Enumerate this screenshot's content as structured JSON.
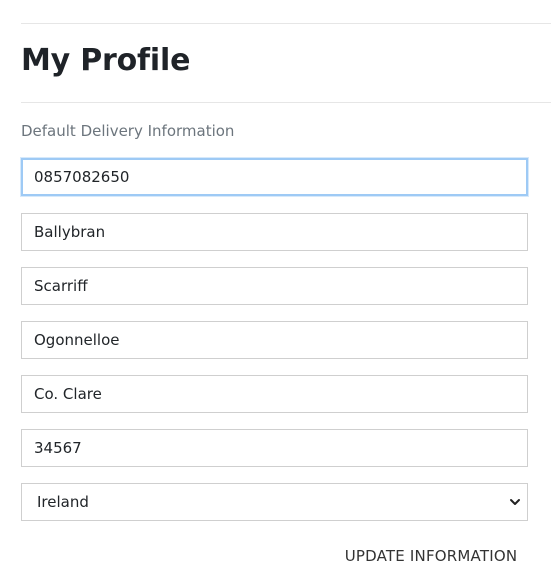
{
  "profile": {
    "title": "My Profile",
    "section_label": "Default Delivery Information",
    "fields": {
      "phone": "0857082650",
      "street1": "Ballybran",
      "street2": "Scarriff",
      "town": "Ogonnelloe",
      "county": "Co. Clare",
      "postcode": "34567"
    },
    "country": {
      "selected": "Ireland"
    },
    "update_label": "UPDATE INFORMATION"
  },
  "icons": {
    "select_chevron": "chevron-down-icon"
  },
  "colors": {
    "focus_border": "#9ecaf5",
    "field_border": "#cfcfcf",
    "label_text": "#6c757d",
    "title_text": "#1f2328"
  }
}
